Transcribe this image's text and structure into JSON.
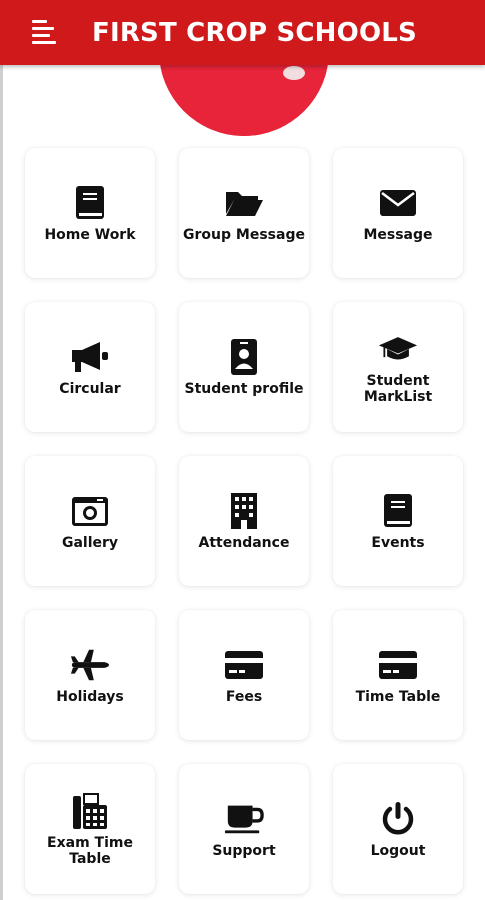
{
  "header": {
    "title": "FIRST CROP SCHOOLS",
    "menu_icon": "menu-icon",
    "background": "#d0191b"
  },
  "tiles": [
    {
      "label": "Home Work",
      "icon": "book-icon"
    },
    {
      "label": "Group Message",
      "icon": "folder-icon"
    },
    {
      "label": "Message",
      "icon": "envelope-icon"
    },
    {
      "label": "Circular",
      "icon": "megaphone-icon"
    },
    {
      "label": "Student profile",
      "icon": "id-badge-icon"
    },
    {
      "label": "Student MarkList",
      "icon": "graduation-cap-icon"
    },
    {
      "label": "Gallery",
      "icon": "camera-icon"
    },
    {
      "label": "Attendance",
      "icon": "building-icon"
    },
    {
      "label": "Events",
      "icon": "book-icon"
    },
    {
      "label": "Holidays",
      "icon": "airplane-icon"
    },
    {
      "label": "Fees",
      "icon": "credit-card-icon"
    },
    {
      "label": "Time Table",
      "icon": "credit-card-icon"
    },
    {
      "label": "Exam Time Table",
      "icon": "fax-icon"
    },
    {
      "label": "Support",
      "icon": "coffee-cup-icon"
    },
    {
      "label": "Logout",
      "icon": "power-icon"
    }
  ]
}
